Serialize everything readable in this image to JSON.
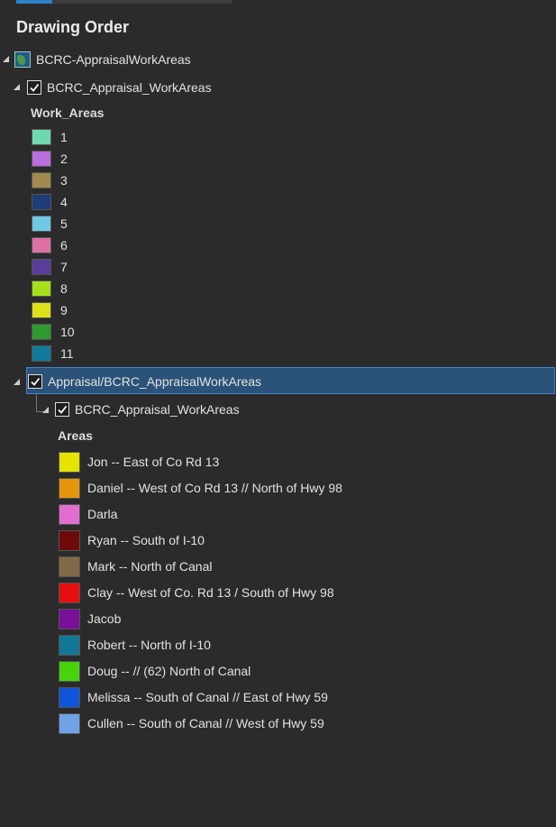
{
  "tab_indicator": {},
  "panel": {
    "title": "Drawing Order"
  },
  "map": {
    "name": "BCRC-AppraisalWorkAreas"
  },
  "layer1": {
    "name": "BCRC_Appraisal_WorkAreas",
    "field": "Work_Areas",
    "classes": [
      {
        "label": "1",
        "color": "#6fd8b0"
      },
      {
        "label": "2",
        "color": "#b96fdc"
      },
      {
        "label": "3",
        "color": "#a08a4f"
      },
      {
        "label": "4",
        "color": "#1f3d78"
      },
      {
        "label": "5",
        "color": "#6fc9e6"
      },
      {
        "label": "6",
        "color": "#dc6fa6"
      },
      {
        "label": "7",
        "color": "#5a3d99"
      },
      {
        "label": "8",
        "color": "#a6e01a"
      },
      {
        "label": "9",
        "color": "#e0e01a"
      },
      {
        "label": "10",
        "color": "#2f9a2f"
      },
      {
        "label": "11",
        "color": "#127a9a"
      }
    ]
  },
  "group": {
    "name": "Appraisal/BCRC_AppraisalWorkAreas"
  },
  "layer2": {
    "name": "BCRC_Appraisal_WorkAreas",
    "field": "Areas",
    "classes": [
      {
        "label": "Jon -- East of Co Rd 13",
        "color": "#e4e400"
      },
      {
        "label": "Daniel -- West of Co Rd 13 // North of Hwy 98",
        "color": "#e3960d"
      },
      {
        "label": "Darla",
        "color": "#e06ecf"
      },
      {
        "label": "Ryan -- South of I-10",
        "color": "#6e0a0a"
      },
      {
        "label": "Mark --  North of Canal",
        "color": "#7f6a45"
      },
      {
        "label": "Clay -- West of Co. Rd 13 / South of Hwy 98",
        "color": "#e50f0f"
      },
      {
        "label": "Jacob",
        "color": "#7a0f9a"
      },
      {
        "label": "Robert -- North of I-10",
        "color": "#127896"
      },
      {
        "label": "Doug -- // (62) North of Canal",
        "color": "#47d40f"
      },
      {
        "label": "Melissa -- South of Canal // East of Hwy 59",
        "color": "#0f55d9"
      },
      {
        "label": "Cullen -- South of Canal // West of Hwy 59",
        "color": "#6fa3e6"
      }
    ]
  }
}
